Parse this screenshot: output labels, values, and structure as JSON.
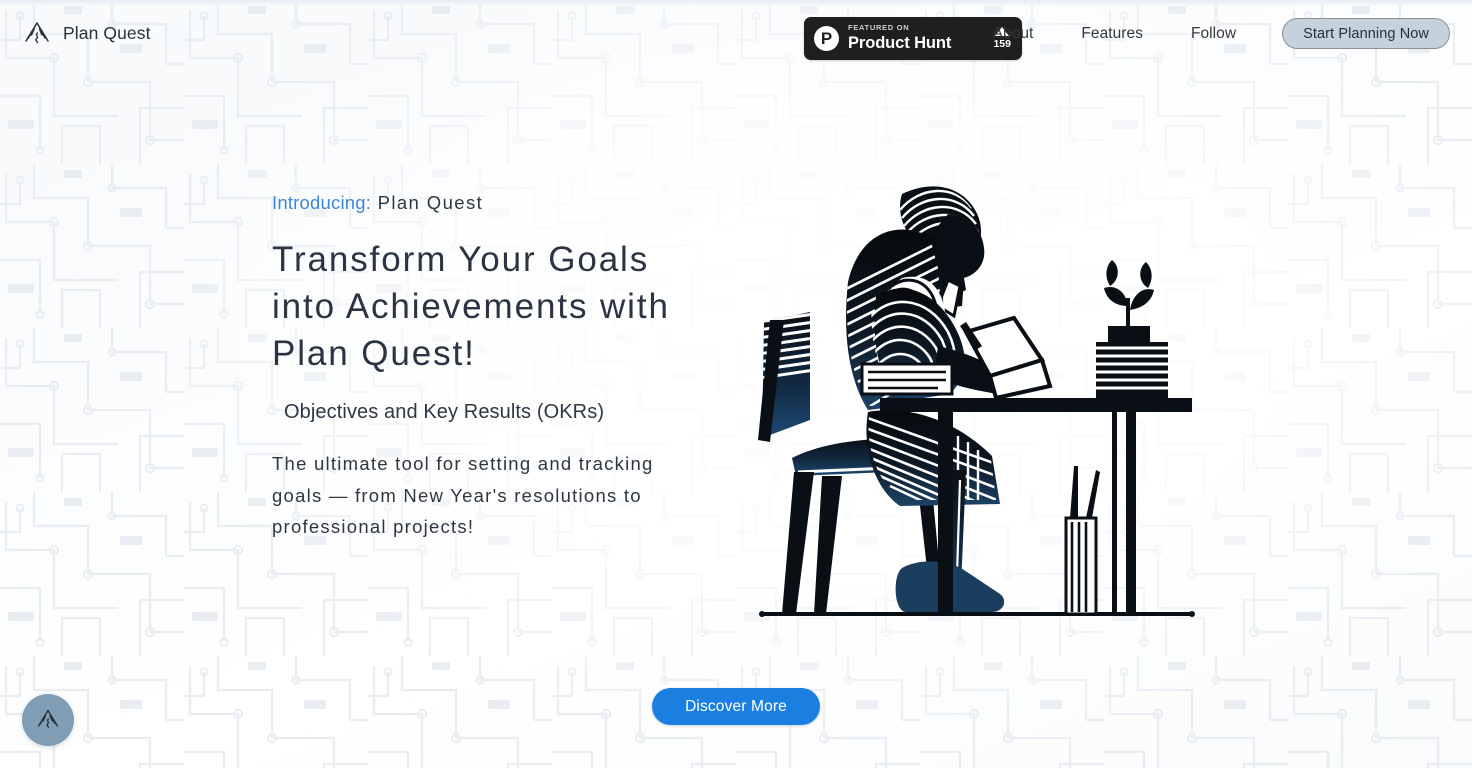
{
  "brand": {
    "name": "Plan Quest",
    "logo_icon": "mountain-peak-icon"
  },
  "header": {
    "product_hunt": {
      "kicker": "FEATURED ON",
      "title": "Product Hunt",
      "logo_letter": "P",
      "logo_icon": "product-hunt-circle-icon",
      "upvote_icon": "triangle-up-icon",
      "upvote_count": "159"
    },
    "nav": [
      {
        "label": "About"
      },
      {
        "label": "Features"
      },
      {
        "label": "Follow"
      }
    ],
    "cta": {
      "label": "Start Planning Now",
      "bg_color": "#c5d2de",
      "border_color": "#8c8f94",
      "text_color": "#23303c"
    }
  },
  "hero": {
    "eyebrow_accent": "Introducing:",
    "eyebrow_rest": " Plan Quest",
    "headline": "Transform Your Goals into Achievements with Plan Quest!",
    "subhead": "Objectives and Key Results (OKRs)",
    "body": "The ultimate tool for setting and tracking goals — from New Year's resolutions to professional projects!",
    "illustration_name": "person-writing-at-desk-illustration",
    "accent_color": "#3b87d6",
    "text_color": "#2c3443"
  },
  "discover": {
    "label": "Discover More",
    "bg_color": "#1a7fe0",
    "text_color": "#ffffff"
  },
  "fab": {
    "icon": "mountain-peak-icon",
    "bg_color": "#7f9db4"
  },
  "background": {
    "pattern": "circuit-board-traces",
    "base_color": "#fbfcfd"
  }
}
